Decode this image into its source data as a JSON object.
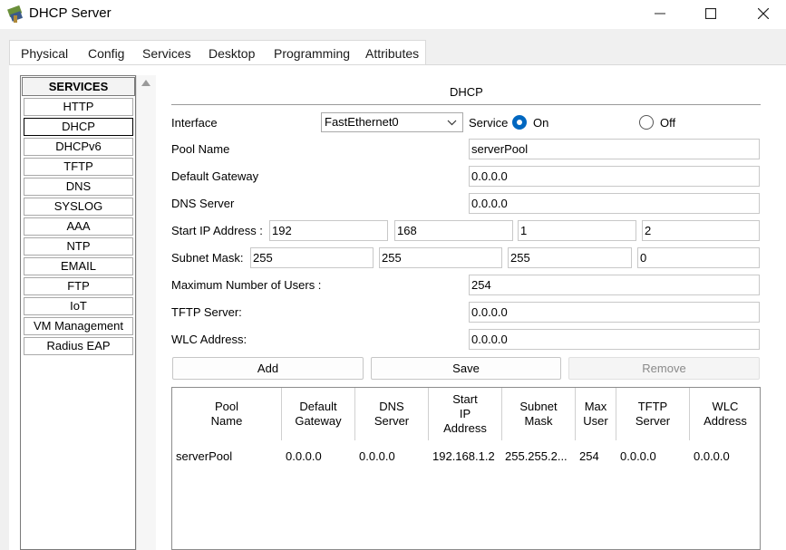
{
  "window": {
    "title": "DHCP Server",
    "min_icon": "minimize-icon",
    "max_icon": "maximize-icon",
    "close_icon": "close-icon"
  },
  "tabs": [
    "Physical",
    "Config",
    "Services",
    "Desktop",
    "Programming",
    "Attributes"
  ],
  "services": {
    "header": "SERVICES",
    "items": [
      "HTTP",
      "DHCP",
      "DHCPv6",
      "TFTP",
      "DNS",
      "SYSLOG",
      "AAA",
      "NTP",
      "EMAIL",
      "FTP",
      "IoT",
      "VM Management",
      "Radius EAP"
    ],
    "selected": "DHCP"
  },
  "dhcp": {
    "title": "DHCP",
    "interface_label": "Interface",
    "interface_value": "FastEthernet0",
    "service_label": "Service",
    "on_label": "On",
    "off_label": "Off",
    "service_on": true,
    "pool_name_label": "Pool Name",
    "pool_name": "serverPool",
    "default_gateway_label": "Default Gateway",
    "default_gateway": "0.0.0.0",
    "dns_server_label": "DNS Server",
    "dns_server": "0.0.0.0",
    "start_ip_label": "Start IP Address :",
    "start_ip": [
      "192",
      "168",
      "1",
      "2"
    ],
    "subnet_label": "Subnet Mask:",
    "subnet": [
      "255",
      "255",
      "255",
      "0"
    ],
    "max_users_label": "Maximum Number of Users :",
    "max_users": "254",
    "tftp_label": "TFTP Server:",
    "tftp": "0.0.0.0",
    "wlc_label": "WLC Address:",
    "wlc": "0.0.0.0",
    "add_label": "Add",
    "save_label": "Save",
    "remove_label": "Remove"
  },
  "table": {
    "headers": [
      [
        "Pool",
        "Name"
      ],
      [
        "Default",
        "Gateway"
      ],
      [
        "DNS",
        "Server"
      ],
      [
        "Start",
        "IP",
        "Address"
      ],
      [
        "Subnet",
        "Mask"
      ],
      [
        "Max",
        "User"
      ],
      [
        "TFTP",
        "Server"
      ],
      [
        "WLC",
        "Address"
      ]
    ],
    "rows": [
      [
        "serverPool",
        "0.0.0.0",
        "0.0.0.0",
        "192.168.1.2",
        "255.255.2...",
        "254",
        "0.0.0.0",
        "0.0.0.0"
      ]
    ]
  }
}
